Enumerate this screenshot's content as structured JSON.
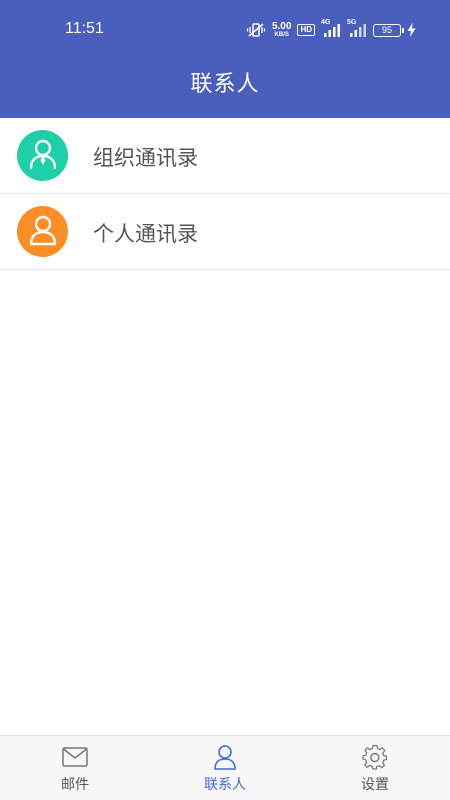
{
  "status_bar": {
    "time": "11:51",
    "net_speed_value": "5.00",
    "net_speed_unit": "KB/S",
    "hd_label": "HD",
    "signal_1_label": "4G",
    "signal_2_label": "5G",
    "battery_level": "95"
  },
  "header": {
    "title": "联系人",
    "background_color": "#4a5fbd"
  },
  "contacts": {
    "items": [
      {
        "label": "组织通讯录",
        "icon": "org-contact-icon",
        "color": "#1fcfa8"
      },
      {
        "label": "个人通讯录",
        "icon": "person-icon",
        "color": "#fb8e25"
      }
    ]
  },
  "tabbar": {
    "tabs": [
      {
        "label": "邮件",
        "icon": "mail-icon",
        "active": false
      },
      {
        "label": "联系人",
        "icon": "person-icon",
        "active": true
      },
      {
        "label": "设置",
        "icon": "gear-icon",
        "active": false
      }
    ],
    "active_color": "#3f6fd6"
  }
}
